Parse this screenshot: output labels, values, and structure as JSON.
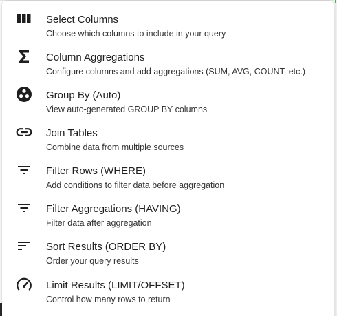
{
  "menu": {
    "items": [
      {
        "icon": "columns-icon",
        "title": "Select Columns",
        "description": "Choose which columns to include in your query"
      },
      {
        "icon": "sigma-icon",
        "title": "Column Aggregations",
        "description": "Configure columns and add aggregations (SUM, AVG, COUNT, etc.)"
      },
      {
        "icon": "workspaces-icon",
        "title": "Group By (Auto)",
        "description": "View auto-generated GROUP BY columns"
      },
      {
        "icon": "link-icon",
        "title": "Join Tables",
        "description": "Combine data from multiple sources"
      },
      {
        "icon": "filter-icon",
        "title": "Filter Rows (WHERE)",
        "description": "Add conditions to filter data before aggregation"
      },
      {
        "icon": "filter-icon",
        "title": "Filter Aggregations (HAVING)",
        "description": "Filter data after aggregation"
      },
      {
        "icon": "sort-icon",
        "title": "Sort Results (ORDER BY)",
        "description": "Order your query results"
      },
      {
        "icon": "speed-icon",
        "title": "Limit Results (LIMIT/OFFSET)",
        "description": "Control how many rows to return"
      }
    ]
  },
  "colors": {
    "icon": "#1f1f1f",
    "title": "#1f1f1f",
    "description": "#333333",
    "surface": "#ffffff"
  }
}
